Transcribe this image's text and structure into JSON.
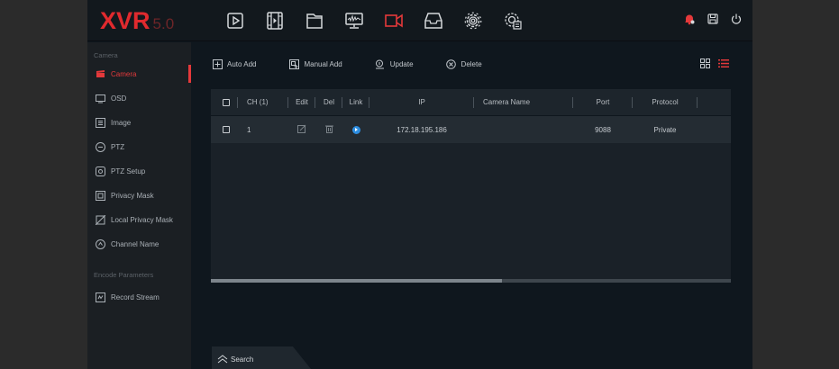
{
  "logo": {
    "brand": "XVR",
    "version": "5.0"
  },
  "topbar": {
    "icons": [
      "playback-icon",
      "video-file-icon",
      "folder-icon",
      "monitor-icon",
      "camera-icon",
      "storage-icon",
      "settings-gear-icon",
      "system-gear-icon"
    ],
    "active_icon": "camera-icon",
    "right_icons": [
      "alarm-bell-icon",
      "save-icon",
      "power-icon"
    ]
  },
  "sidebar": {
    "section_camera": "Camera",
    "items": [
      {
        "label": "Camera",
        "icon": "camera-icon",
        "active": true
      },
      {
        "label": "OSD",
        "icon": "osd-icon",
        "active": false
      },
      {
        "label": "Image",
        "icon": "image-icon",
        "active": false
      },
      {
        "label": "PTZ",
        "icon": "ptz-icon",
        "active": false
      },
      {
        "label": "PTZ Setup",
        "icon": "ptz-setup-icon",
        "active": false
      },
      {
        "label": "Privacy Mask",
        "icon": "privacy-mask-icon",
        "active": false
      },
      {
        "label": "Local Privacy Mask",
        "icon": "local-privacy-mask-icon",
        "active": false
      },
      {
        "label": "Channel Name",
        "icon": "channel-name-icon",
        "active": false
      }
    ],
    "section_encode": "Encode Parameters",
    "encode_items": [
      {
        "label": "Record Stream",
        "icon": "record-stream-icon"
      }
    ]
  },
  "toolbar": {
    "auto_add": "Auto Add",
    "manual_add": "Manual Add",
    "update": "Update",
    "delete": "Delete"
  },
  "table": {
    "headers": {
      "ch": "CH (1)",
      "edit": "Edit",
      "del": "Del",
      "link": "Link",
      "ip": "IP",
      "camera_name": "Camera Name",
      "port": "Port",
      "protocol": "Protocol"
    },
    "rows": [
      {
        "ch": "1",
        "ip": "172.18.195.186",
        "camera_name": "",
        "port": "9088",
        "protocol": "Private"
      }
    ],
    "scroll_position_fraction": 0.56
  },
  "search_tab": {
    "label": "Search"
  },
  "colors": {
    "accent": "#e5393b",
    "link": "#2d8de0",
    "background": "#0f171e",
    "sidebar": "#1b1f23"
  }
}
